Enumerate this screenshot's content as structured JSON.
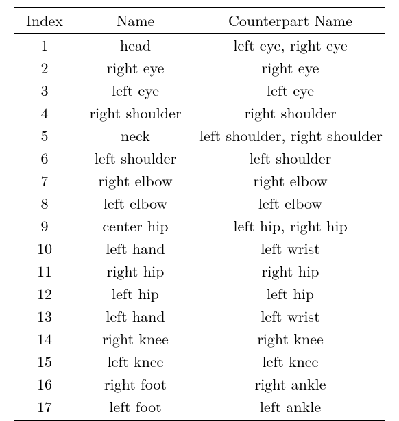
{
  "chart_data": {
    "type": "table",
    "columns": [
      "Index",
      "Name",
      "Counterpart Name"
    ],
    "rows": [
      {
        "index": "1",
        "name": "head",
        "counterpart": "left eye, right eye"
      },
      {
        "index": "2",
        "name": "right eye",
        "counterpart": "right eye"
      },
      {
        "index": "3",
        "name": "left eye",
        "counterpart": "left eye"
      },
      {
        "index": "4",
        "name": "right shoulder",
        "counterpart": "right shoulder"
      },
      {
        "index": "5",
        "name": "neck",
        "counterpart": "left shoulder, right shoulder"
      },
      {
        "index": "6",
        "name": "left shoulder",
        "counterpart": "left shoulder"
      },
      {
        "index": "7",
        "name": "right elbow",
        "counterpart": "right elbow"
      },
      {
        "index": "8",
        "name": "left elbow",
        "counterpart": "left elbow"
      },
      {
        "index": "9",
        "name": "center hip",
        "counterpart": "left hip, right hip"
      },
      {
        "index": "10",
        "name": "left hand",
        "counterpart": "left wrist"
      },
      {
        "index": "11",
        "name": "right hip",
        "counterpart": "right hip"
      },
      {
        "index": "12",
        "name": "left hip",
        "counterpart": "left hip"
      },
      {
        "index": "13",
        "name": "left hand",
        "counterpart": "left wrist"
      },
      {
        "index": "14",
        "name": "right knee",
        "counterpart": "right knee"
      },
      {
        "index": "15",
        "name": "left knee",
        "counterpart": "left knee"
      },
      {
        "index": "16",
        "name": "right foot",
        "counterpart": "right ankle"
      },
      {
        "index": "17",
        "name": "left foot",
        "counterpart": "left ankle"
      }
    ]
  }
}
